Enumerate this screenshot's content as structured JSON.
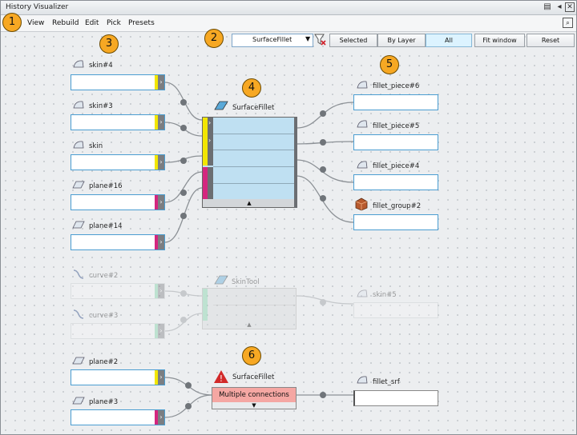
{
  "window": {
    "title": "History Visualizer"
  },
  "menu": [
    "View",
    "Rebuild",
    "Edit",
    "Pick",
    "Presets"
  ],
  "toolbar": {
    "filter_value": "SurfaceFillet",
    "buttons": [
      "Selected",
      "By Layer",
      "All",
      "Fit window",
      "Reset"
    ],
    "active": [
      "All"
    ]
  },
  "callouts": [
    "1",
    "2",
    "3",
    "4",
    "5",
    "6"
  ],
  "graph1": {
    "inputs": [
      "skin#4",
      "skin#3",
      "skin",
      "plane#16",
      "plane#14"
    ],
    "node": "SurfaceFillet",
    "outputs": [
      "fillet_piece#6",
      "fillet_piece#5",
      "fillet_piece#4",
      "fillet_group#2"
    ]
  },
  "graph2": {
    "inputs": [
      "curve#2",
      "curve#3"
    ],
    "node": "SkinTool",
    "outputs": [
      "skin#5"
    ]
  },
  "graph3": {
    "inputs": [
      "plane#2",
      "plane#3"
    ],
    "node": "SurfaceFillet",
    "node_status": "Multiple connections",
    "outputs": [
      "fillet_srf"
    ]
  },
  "colors": {
    "yellow": "#f2e600",
    "magenta": "#d4267f",
    "wire": "#8c9196",
    "node_fill": "#bfe0f2",
    "error_fill": "#f5a7a3"
  }
}
